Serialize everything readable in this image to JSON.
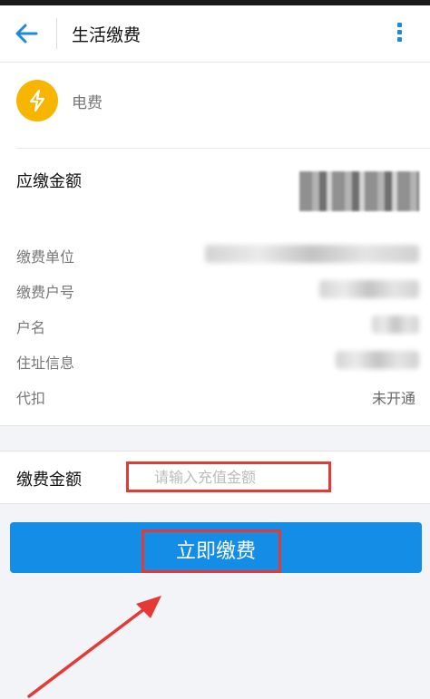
{
  "header": {
    "title": "生活缴费"
  },
  "bill": {
    "utility_type": "电费",
    "amount_due_label": "应缴金额",
    "details": {
      "unit_label": "缴费单位",
      "account_label": "缴费户号",
      "name_label": "户名",
      "address_label": "住址信息",
      "autopay_label": "代扣",
      "autopay_value": "未开通"
    }
  },
  "payment": {
    "amount_label": "缴费金额",
    "amount_placeholder": "请输入充值金额",
    "submit_label": "立即缴费"
  },
  "colors": {
    "accent": "#148de6",
    "icon_bg": "#f7b500",
    "annotation": "#e53935"
  },
  "icons": [
    "back-arrow-icon",
    "more-vertical-icon",
    "lightning-icon"
  ]
}
